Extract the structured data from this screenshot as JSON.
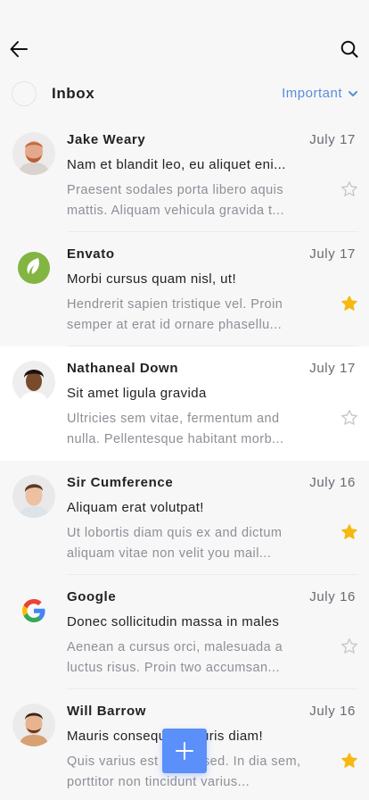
{
  "header": {
    "title": "Inbox",
    "filter_label": "Important"
  },
  "colors": {
    "accent": "#5b8ff9",
    "star_active": "#f5b90f",
    "star_inactive": "#c8c8cc"
  },
  "emails": [
    {
      "sender": "Jake Weary",
      "date": "July 17",
      "subject": "Nam et blandit leo, eu aliquet eni...",
      "preview": "Praesent sodales porta libero aquis mattis. Aliquam vehicula gravida t...",
      "starred": false,
      "avatar": "person-photo"
    },
    {
      "sender": "Envato",
      "date": "July 17",
      "subject": "Morbi cursus quam nisl, ut!",
      "preview": "Hendrerit sapien tristique vel. Proin semper at erat id ornare phasellu...",
      "starred": true,
      "avatar": "envato-logo"
    },
    {
      "sender": "Nathaneal Down",
      "date": "July 17",
      "subject": "Sit amet ligula gravida",
      "preview": "Ultricies sem vitae, fermentum and nulla. Pellentesque habitant morb...",
      "starred": false,
      "avatar": "person-photo"
    },
    {
      "sender": "Sir Cumference",
      "date": "July 16",
      "subject": "Aliquam erat volutpat!",
      "preview": "Ut lobortis diam quis ex and dictum aliquam vitae non velit you mail...",
      "starred": true,
      "avatar": "person-photo"
    },
    {
      "sender": "Google",
      "date": "July 16",
      "subject": "Donec sollicitudin massa in males",
      "preview": "Aenean a cursus orci, malesuada a luctus risus. Proin two accumsan...",
      "starred": false,
      "avatar": "google-logo"
    },
    {
      "sender": "Will Barrow",
      "date": "July 16",
      "subject": "Mauris consequat mauris diam!",
      "preview": "Quis varius est mattis sed. In dia sem, porttitor non tincidunt varius...",
      "starred": true,
      "avatar": "person-photo"
    }
  ]
}
